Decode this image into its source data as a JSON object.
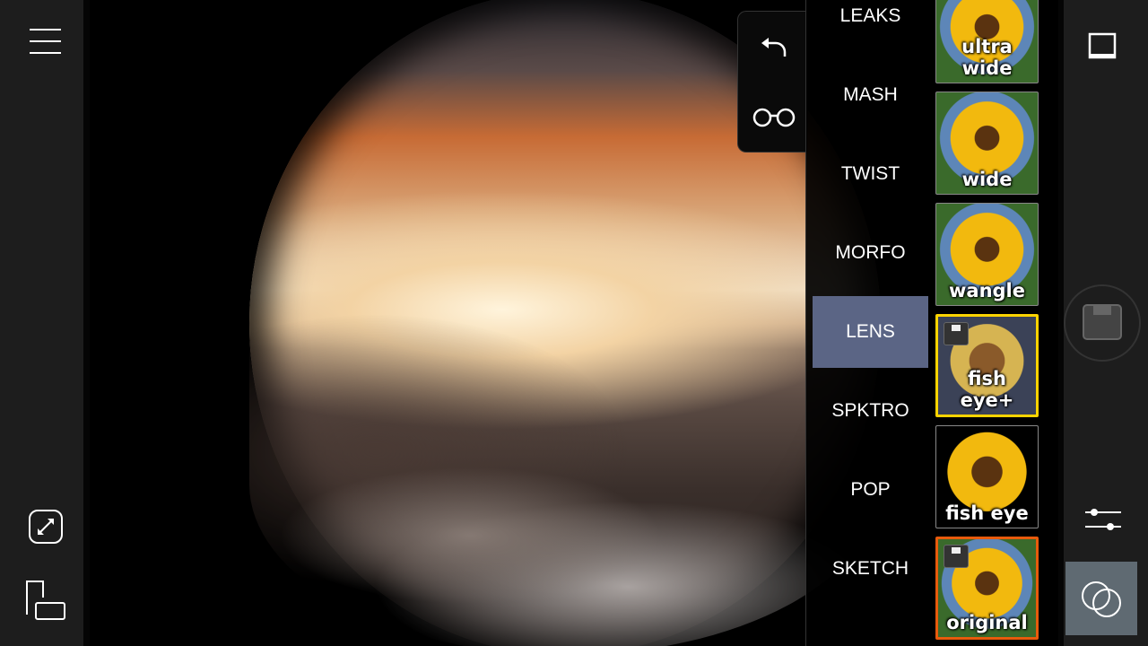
{
  "left_toolbar": {
    "icons": [
      "menu-icon",
      "fullscreen-icon",
      "layout-icon"
    ]
  },
  "tabs": {
    "icons": [
      "undo-icon",
      "glasses-icon"
    ]
  },
  "categories": [
    {
      "label": "LEAKS"
    },
    {
      "label": "MASH"
    },
    {
      "label": "TWIST"
    },
    {
      "label": "MORFO"
    },
    {
      "label": "LENS",
      "selected": true
    },
    {
      "label": "SPKTRO"
    },
    {
      "label": "POP"
    },
    {
      "label": "SKETCH"
    }
  ],
  "presets": [
    {
      "label": "ultra wide"
    },
    {
      "label": "wide"
    },
    {
      "label": "wangle"
    },
    {
      "label": "fish eye+",
      "selected": true,
      "saved": true
    },
    {
      "label": "fish eye"
    },
    {
      "label": "original",
      "saved": true
    }
  ],
  "right_toolbar": {
    "icons": [
      "frame-icon",
      "save-icon",
      "sliders-icon",
      "blend-icon"
    ]
  },
  "colors": {
    "selected_category": "#5b6585",
    "selected_preset": "#ffd400",
    "original_preset": "#e85a0c"
  }
}
